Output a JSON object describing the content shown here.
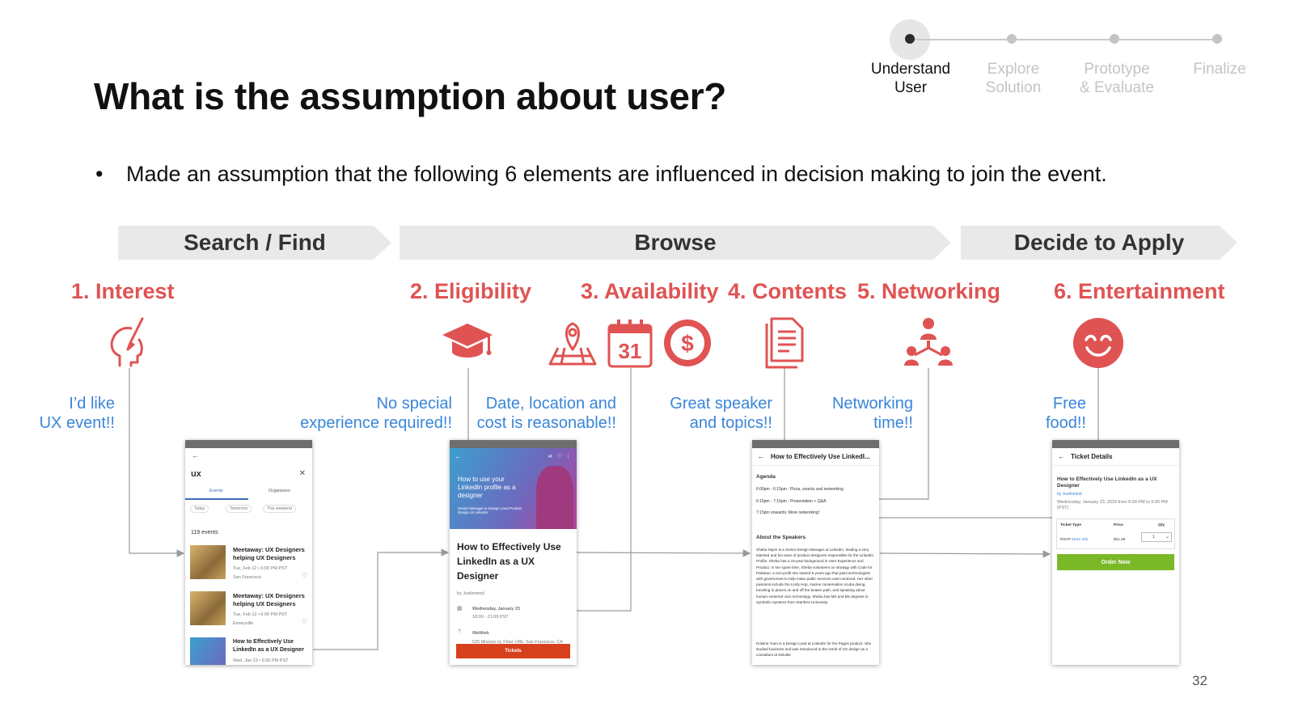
{
  "slide": {
    "title": "What is the assumption about user?",
    "bullet": "Made an assumption that the following 6 elements are influenced in decision making to join the event.",
    "page_number": "32"
  },
  "stepper": {
    "steps": [
      {
        "label_line1": "Understand",
        "label_line2": "User"
      },
      {
        "label_line1": "Explore",
        "label_line2": "Solution"
      },
      {
        "label_line1": "Prototype",
        "label_line2": "& Evaluate"
      },
      {
        "label_line1": "Finalize",
        "label_line2": ""
      }
    ],
    "active_index": 0
  },
  "phases": [
    "Search / Find",
    "Browse",
    "Decide to Apply"
  ],
  "elements": [
    {
      "label": "1. Interest",
      "icon": "head-idea-icon"
    },
    {
      "label": "2. Eligibility",
      "icon": "graduation-cap-icon"
    },
    {
      "label": "3. Availability",
      "icon": "map-calendar-dollar-icon"
    },
    {
      "label": "4. Contents",
      "icon": "document-icon"
    },
    {
      "label": "5. Networking",
      "icon": "network-people-icon"
    },
    {
      "label": "6. Entertainment",
      "icon": "smiley-face-icon"
    }
  ],
  "calendar_day": "31",
  "notes": [
    {
      "line1": "I’d like",
      "line2": "UX event!!"
    },
    {
      "line1": "No special",
      "line2": "experience required!!"
    },
    {
      "line1": "Date, location and",
      "line2": "cost is reasonable!!"
    },
    {
      "line1": "Great speaker",
      "line2": "and topics!!"
    },
    {
      "line1": "Networking",
      "line2": "time!!"
    },
    {
      "line1": "Free",
      "line2": "food!!"
    }
  ],
  "screens": {
    "search": {
      "query": "ux",
      "tabs": [
        "Events",
        "Organizers"
      ],
      "filters": [
        "Today",
        "Tomorrow",
        "This weekend"
      ],
      "count": "119 events",
      "events": [
        {
          "title": "Meetaway: UX Designers helping UX Designers",
          "date": "Tue, Feb 12 • 6:00 PM PST",
          "place": "San Francisco"
        },
        {
          "title": "Meetaway: UX Designers helping UX Designers",
          "date": "Tue, Feb 12 • 6:00 PM PST",
          "place": "Emeryville"
        },
        {
          "title": "How to Effectively Use LinkedIn as a UX Designer",
          "date": "Wed, Jan 23 • 6:00 PM PST",
          "place": ""
        }
      ]
    },
    "event": {
      "hero_text": "How to use your LinkedIn profile as a designer",
      "hero_sub": "Senior Manager & Design Lead Product Design at LinkedIn",
      "title": "How to Effectively Use LinkedIn as a UX Designer",
      "by": "by Justinmind",
      "date": "Wednesday, January 23",
      "time": "18:00 - 21:00 PST",
      "venue": "WeWork",
      "address": "535 Mission st, Floor 14th, San Francisco, CA",
      "button": "Tickets"
    },
    "details": {
      "header": "How to Effectively Use LinkedI...",
      "agenda_title": "Agenda",
      "agenda": [
        "6:00pm - 6:15pm : Pizza, snacks and networking",
        "6:15pm - 7:15pm : Presentation + Q&A",
        "7:15pm onwards: More networking!"
      ],
      "speakers_title": "About the Speakers",
      "speaker1": "Sheba Najmi is a Senior Design Manager at LinkedIn, leading a very talented and fun team of product designers responsible for the LinkedIn Profile. Sheba has a 15-year background in User Experience and Product. In her spare time, Sheba volunteers on strategy with Code for Pakistan, a non-profit she started 6 years ago that pairs technologists with government to help make public services user-centered. Her other passions include the Lindy Hop, marine conservation scuba diving, traveling to places on and off the beaten path, and speaking about human-centered civic technology. Sheba has MS and BS degrees in Symbolic Systems from Stanford University.",
      "speaker2": "Kristine Yuen is a Design Lead at LinkedIn for the Pages product. She studied business and was introduced to the world of UX design as a consultant at Deloitte"
    },
    "ticket": {
      "header": "Ticket Details",
      "title": "How to Effectively Use LinkedIn as a UX Designer",
      "by": "by Justinmind",
      "datetime": "Wednesday, January 23, 2019 from 6:00 PM to 9:00 PM (PST)",
      "col_type": "Ticket Type",
      "col_price": "Price",
      "col_qty": "Qty",
      "row_type": "RSVP",
      "row_more": "More info",
      "row_price": "$11.26",
      "row_qty": "1",
      "button": "Order Now"
    }
  },
  "colors": {
    "accent_red": "#e05353",
    "note_blue": "#3a85d8",
    "phase_gray": "#e9e9e9",
    "order_green": "#7ab828",
    "ticket_orange": "#d6401c"
  }
}
